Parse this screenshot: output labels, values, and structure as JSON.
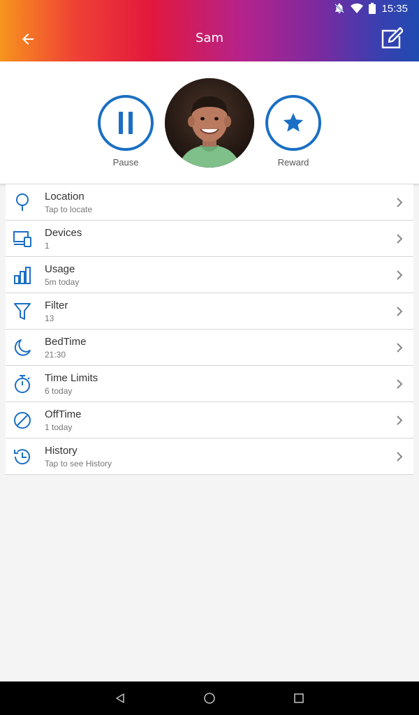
{
  "status_bar": {
    "time": "15:35",
    "icons": [
      "notifications-off-icon",
      "wifi-icon",
      "battery-icon"
    ]
  },
  "app_bar": {
    "title": "Sam",
    "back_icon": "arrow-left-icon",
    "edit_icon": "edit-icon"
  },
  "profile": {
    "pause_label": "Pause",
    "reward_label": "Reward",
    "avatar": "child-avatar"
  },
  "menu": [
    {
      "title": "Location",
      "subtitle": "Tap to locate",
      "icon": "location-pin-icon"
    },
    {
      "title": "Devices",
      "subtitle": "1",
      "icon": "devices-icon"
    },
    {
      "title": "Usage",
      "subtitle": "5m today",
      "icon": "bar-chart-icon"
    },
    {
      "title": "Filter",
      "subtitle": "13",
      "icon": "filter-icon"
    },
    {
      "title": "BedTime",
      "subtitle": "21:30",
      "icon": "moon-icon"
    },
    {
      "title": "Time Limits",
      "subtitle": "6 today",
      "icon": "stopwatch-icon"
    },
    {
      "title": "OffTime",
      "subtitle": "1 today",
      "icon": "block-icon"
    },
    {
      "title": "History",
      "subtitle": "Tap to see History",
      "icon": "history-icon"
    }
  ],
  "colors": {
    "accent": "#1a6fc4",
    "background": "#f4f4f4"
  },
  "nav_bar": {
    "icons": [
      "back-triangle-icon",
      "home-circle-icon",
      "recents-square-icon"
    ]
  }
}
